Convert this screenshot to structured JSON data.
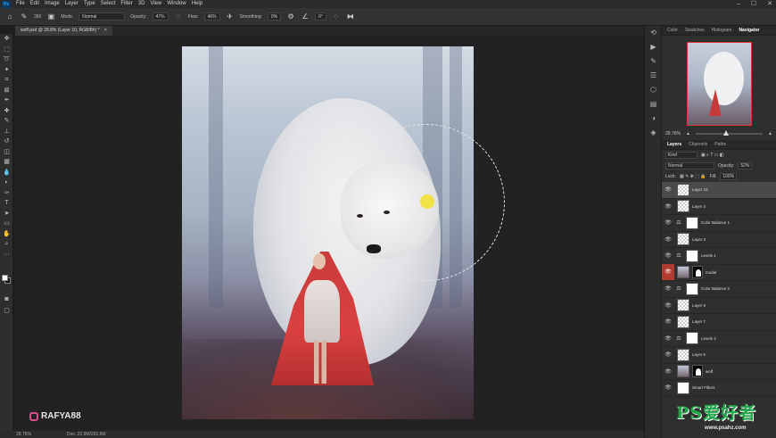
{
  "menu": [
    "File",
    "Edit",
    "Image",
    "Layer",
    "Type",
    "Select",
    "Filter",
    "3D",
    "View",
    "Window",
    "Help"
  ],
  "app_badge": "Ps",
  "options": {
    "brush_size": "350",
    "mode_label": "Mode:",
    "mode_value": "Normal",
    "opacity_label": "Opacity:",
    "opacity_value": "47%",
    "flow_label": "Flow:",
    "flow_value": "46%",
    "smoothing_label": "Smoothing:",
    "smoothing_value": "0%",
    "angle_value": "0°"
  },
  "document_tab": "wolf.psd @ 28.8% (Layer 10, RGB/8#) *",
  "watermark": "RAFYA88",
  "status": {
    "zoom": "28.76%",
    "doc": "Doc: 22.9M/282.6M"
  },
  "right_tabs": [
    "Color",
    "Swatches",
    "Histogram",
    "Navigator"
  ],
  "navigator": {
    "zoom": "28.76%"
  },
  "layers_tabs": [
    "Layers",
    "Channels",
    "Paths"
  ],
  "layers_controls": {
    "kind": "Kind",
    "blend": "Normal",
    "opacity_label": "Opacity:",
    "opacity": "52%",
    "lock_label": "Lock:",
    "fill_label": "Fill:",
    "fill": "100%"
  },
  "layers": [
    {
      "name": "Layer 10",
      "thumb": "transparent",
      "active": true,
      "eye": "normal"
    },
    {
      "name": "Layer 4",
      "thumb": "transparent",
      "eye": "normal"
    },
    {
      "name": "Color Balance 1",
      "thumb": "adjust",
      "eye": "normal"
    },
    {
      "name": "Layer 3",
      "thumb": "transparent",
      "eye": "normal"
    },
    {
      "name": "Levels 1",
      "thumb": "adjust",
      "eye": "normal"
    },
    {
      "name": "model",
      "thumb": "image",
      "eye": "red"
    },
    {
      "name": "Color Balance 2",
      "thumb": "adjust",
      "eye": "normal"
    },
    {
      "name": "Layer 9",
      "thumb": "transparent",
      "eye": "normal"
    },
    {
      "name": "Layer 7",
      "thumb": "transparent",
      "eye": "normal"
    },
    {
      "name": "Levels 2",
      "thumb": "adjust",
      "eye": "normal"
    },
    {
      "name": "Layer 5",
      "thumb": "transparent",
      "eye": "normal"
    },
    {
      "name": "wolf",
      "thumb": "image",
      "eye": "normal"
    },
    {
      "name": "Smart Filters",
      "thumb": "white",
      "eye": "normal"
    }
  ],
  "logo": {
    "text": "PS爱好者",
    "url": "www.psahz.com"
  },
  "colors": {
    "accent": "#31a8ff",
    "brush_cursor": "#f2e22a",
    "logo_green": "#24a64a"
  }
}
